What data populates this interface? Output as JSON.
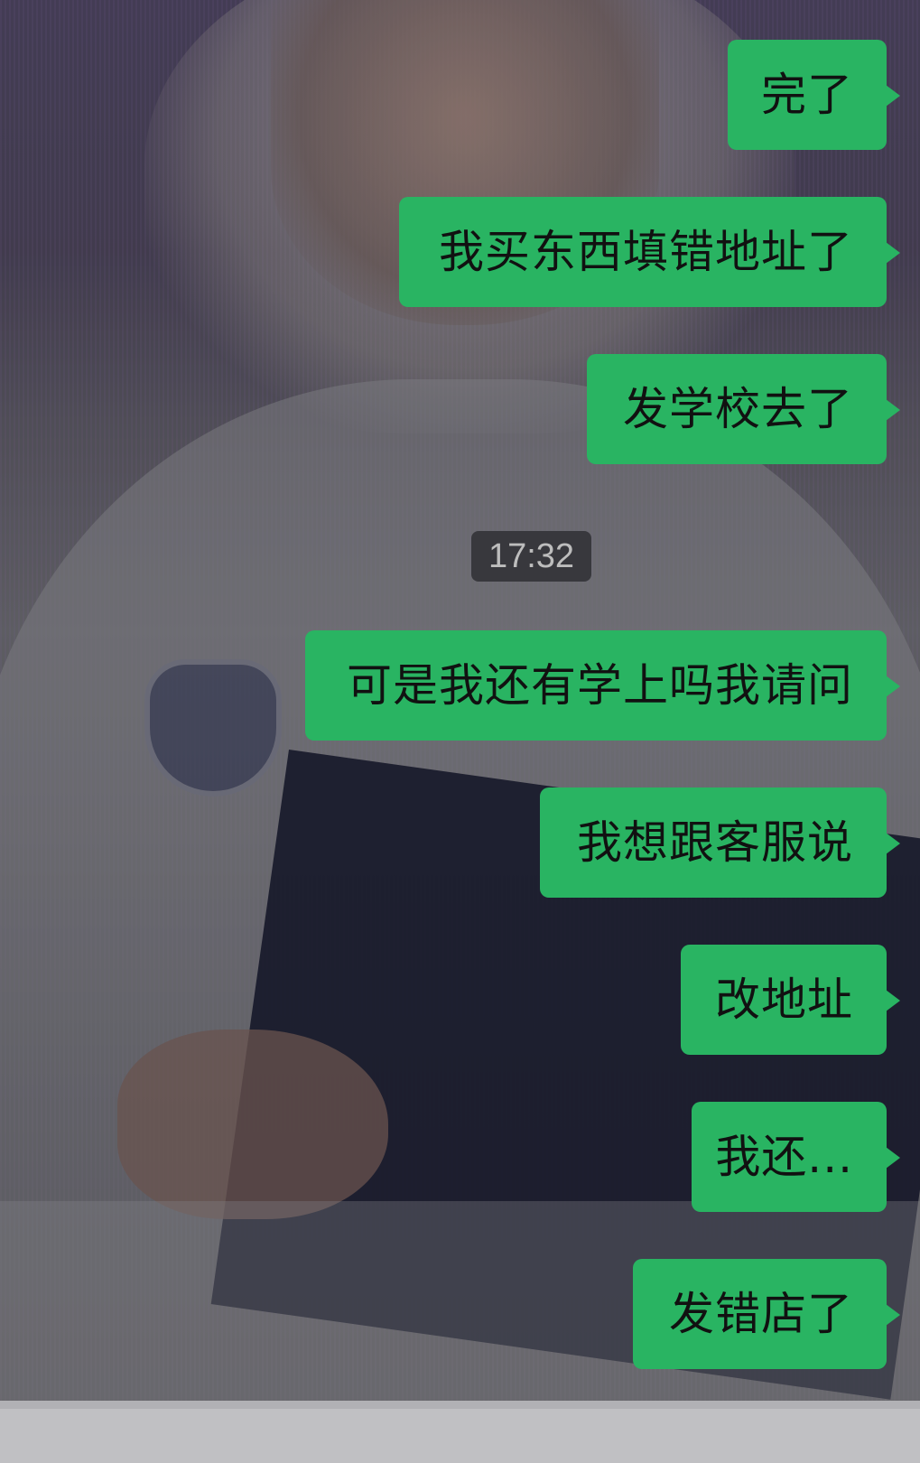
{
  "chat": {
    "messages": [
      {
        "text": "完了",
        "sender": "me"
      },
      {
        "text": "我买东西填错地址了",
        "sender": "me"
      },
      {
        "text": "发学校去了",
        "sender": "me"
      },
      {
        "text": "可是我还有学上吗我请问",
        "sender": "me"
      },
      {
        "text": "我想跟客服说",
        "sender": "me"
      },
      {
        "text": "改地址",
        "sender": "me"
      },
      {
        "text": "我还...",
        "sender": "me"
      },
      {
        "text": "发错店了",
        "sender": "me"
      }
    ],
    "timestamp": "17:32"
  },
  "colors": {
    "sent_bubble": "#29b462",
    "bubble_text": "#111111",
    "timestamp_bg": "#343438",
    "timestamp_text": "#bdbdbd"
  }
}
